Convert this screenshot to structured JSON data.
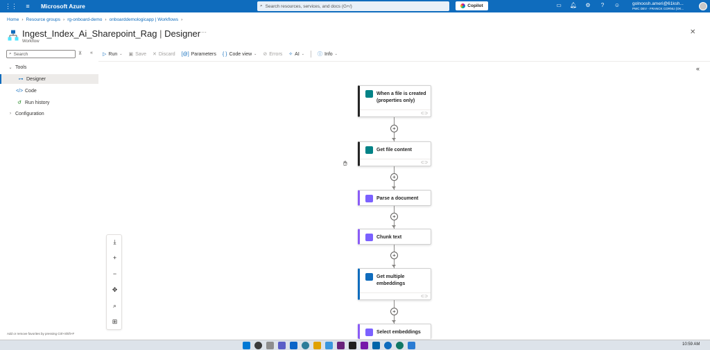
{
  "topbar": {
    "brand": "Microsoft Azure",
    "search_placeholder": "Search resources, services, and docs (G+/)",
    "copilot_label": "Copilot",
    "user_name": "golnoosh.ameri@61ksh...",
    "user_org": "PWC DEV - FRANCK CORNU (OK..."
  },
  "breadcrumb": [
    "Home",
    "Resource groups",
    "rg-onboard-demo",
    "onboarddemologicapp | Workflows"
  ],
  "page": {
    "title": "Ingest_Index_Ai_Sharepoint_Rag",
    "title_suffix": "Designer",
    "subtitle": "Workflow"
  },
  "sidebar": {
    "search_placeholder": "Search",
    "items": [
      {
        "label": "Tools",
        "icon": "chevron-down-icon",
        "expanded": true
      },
      {
        "label": "Designer",
        "icon": "designer-icon",
        "selected": true
      },
      {
        "label": "Code",
        "icon": "code-icon"
      },
      {
        "label": "Run history",
        "icon": "history-icon"
      },
      {
        "label": "Configuration",
        "icon": "chevron-right-icon",
        "expanded": false
      }
    ],
    "footer": "Add or remove favorites by pressing Ctrl+Shift+F"
  },
  "toolbar": {
    "run": "Run",
    "save": "Save",
    "discard": "Discard",
    "parameters": "Parameters",
    "code_view": "Code view",
    "errors": "Errors",
    "ai": "AI",
    "info": "Info"
  },
  "workflow": {
    "steps": [
      {
        "label": "When a file is created (properties only)",
        "kind": "sharepoint"
      },
      {
        "label": "Get file content",
        "kind": "sharepoint"
      },
      {
        "label": "Parse a document",
        "kind": "ai"
      },
      {
        "label": "Chunk text",
        "kind": "ai"
      },
      {
        "label": "Get multiple embeddings",
        "kind": "embeddings"
      },
      {
        "label": "Select embeddings",
        "kind": "ai"
      }
    ]
  },
  "taskbar": {
    "time": "10:59 AM"
  }
}
